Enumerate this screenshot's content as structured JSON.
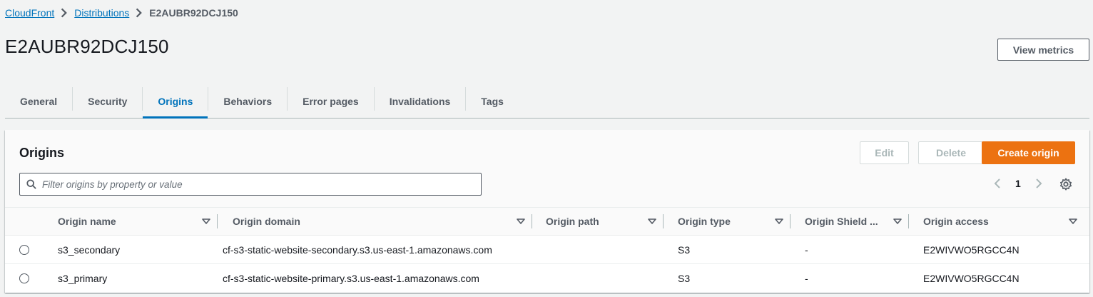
{
  "breadcrumb": {
    "items": [
      "CloudFront",
      "Distributions"
    ],
    "current": "E2AUBR92DCJ150"
  },
  "page": {
    "title": "E2AUBR92DCJ150",
    "view_metrics_label": "View metrics"
  },
  "tabs": [
    "General",
    "Security",
    "Origins",
    "Behaviors",
    "Error pages",
    "Invalidations",
    "Tags"
  ],
  "active_tab": "Origins",
  "panel": {
    "title": "Origins",
    "edit_label": "Edit",
    "delete_label": "Delete",
    "create_label": "Create origin",
    "filter_placeholder": "Filter origins by property or value",
    "page_number": "1"
  },
  "table": {
    "columns": [
      "Origin name",
      "Origin domain",
      "Origin path",
      "Origin type",
      "Origin Shield ...",
      "Origin access"
    ],
    "rows": [
      {
        "name": "s3_secondary",
        "domain": "cf-s3-static-website-secondary.s3.us-east-1.amazonaws.com",
        "path": "",
        "type": "S3",
        "shield": "-",
        "access": "E2WIVWO5RGCC4N"
      },
      {
        "name": "s3_primary",
        "domain": "cf-s3-static-website-primary.s3.us-east-1.amazonaws.com",
        "path": "",
        "type": "S3",
        "shield": "-",
        "access": "E2WIVWO5RGCC4N"
      }
    ]
  },
  "colors": {
    "link": "#0073bb",
    "primary": "#ec7211",
    "text": "#16191f",
    "muted": "#545b64"
  }
}
